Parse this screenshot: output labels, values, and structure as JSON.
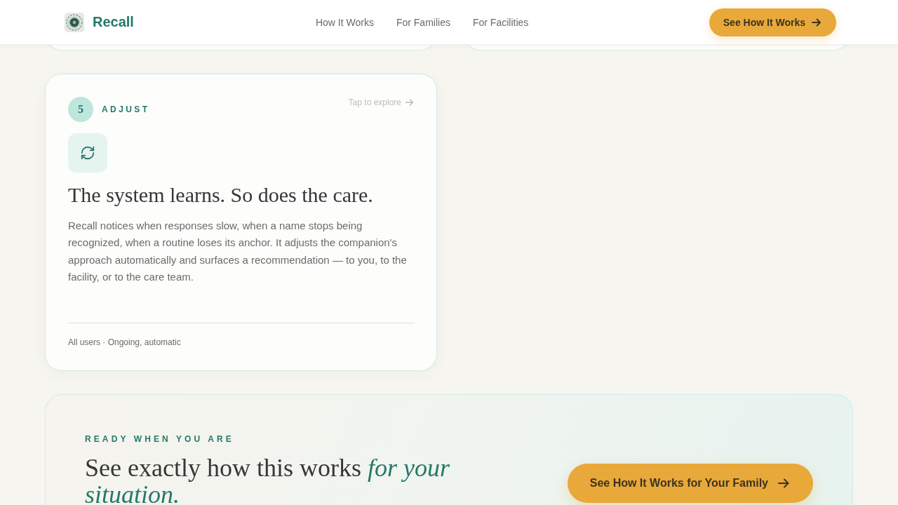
{
  "header": {
    "brand": "Recall",
    "nav": [
      {
        "label": "How It Works"
      },
      {
        "label": "For Families"
      },
      {
        "label": "For Facilities"
      }
    ],
    "cta": "See How It Works"
  },
  "step": {
    "number": "5",
    "label": "ADJUST",
    "hint": "Tap to explore",
    "title": "The system learns. So does the care.",
    "body": "Recall notices when responses slow, when a name stops being recognized, when a routine loses its anchor. It adjusts the companion's approach automatically and surfaces a recommendation — to you, to the facility, or to the care team.",
    "meta": "All users · Ongoing, automatic"
  },
  "cta_section": {
    "eyebrow": "READY WHEN YOU ARE",
    "heading": "See exactly how this works *for your situation.*",
    "button": "See How It Works for Your Family"
  }
}
